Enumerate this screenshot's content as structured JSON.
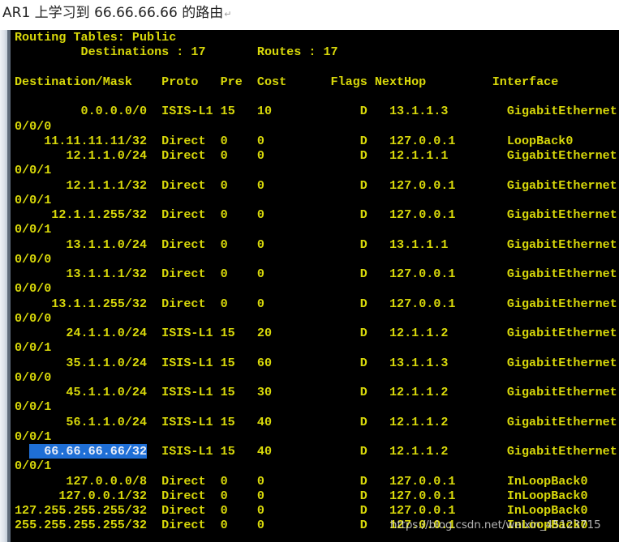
{
  "caption": {
    "text": "AR1 上学习到 66.66.66.66 的路由",
    "paragraph_mark": "↵"
  },
  "terminal": {
    "title": "Routing Tables: Public",
    "destinations_label": "Destinations",
    "destinations_count": "17",
    "routes_label": "Routes",
    "routes_count": "17",
    "columns": [
      "Destination/Mask",
      "Proto",
      "Pre",
      "Cost",
      "Flags",
      "NextHop",
      "Interface"
    ],
    "highlight_color": "#1f6fd6",
    "text_color": "#d8d80a",
    "background_color": "#000000",
    "routes": [
      {
        "dest": "0.0.0.0/0",
        "proto": "ISIS-L1",
        "pre": "15",
        "cost": "10",
        "flags": "D",
        "nexthop": "13.1.1.3",
        "iface": "GigabitEthernet",
        "iface_wrap": "0/0/0"
      },
      {
        "dest": "11.11.11.11/32",
        "proto": "Direct",
        "pre": "0",
        "cost": "0",
        "flags": "D",
        "nexthop": "127.0.0.1",
        "iface": "LoopBack0",
        "iface_wrap": ""
      },
      {
        "dest": "12.1.1.0/24",
        "proto": "Direct",
        "pre": "0",
        "cost": "0",
        "flags": "D",
        "nexthop": "12.1.1.1",
        "iface": "GigabitEthernet",
        "iface_wrap": "0/0/1"
      },
      {
        "dest": "12.1.1.1/32",
        "proto": "Direct",
        "pre": "0",
        "cost": "0",
        "flags": "D",
        "nexthop": "127.0.0.1",
        "iface": "GigabitEthernet",
        "iface_wrap": "0/0/1"
      },
      {
        "dest": "12.1.1.255/32",
        "proto": "Direct",
        "pre": "0",
        "cost": "0",
        "flags": "D",
        "nexthop": "127.0.0.1",
        "iface": "GigabitEthernet",
        "iface_wrap": "0/0/1"
      },
      {
        "dest": "13.1.1.0/24",
        "proto": "Direct",
        "pre": "0",
        "cost": "0",
        "flags": "D",
        "nexthop": "13.1.1.1",
        "iface": "GigabitEthernet",
        "iface_wrap": "0/0/0"
      },
      {
        "dest": "13.1.1.1/32",
        "proto": "Direct",
        "pre": "0",
        "cost": "0",
        "flags": "D",
        "nexthop": "127.0.0.1",
        "iface": "GigabitEthernet",
        "iface_wrap": "0/0/0"
      },
      {
        "dest": "13.1.1.255/32",
        "proto": "Direct",
        "pre": "0",
        "cost": "0",
        "flags": "D",
        "nexthop": "127.0.0.1",
        "iface": "GigabitEthernet",
        "iface_wrap": "0/0/0"
      },
      {
        "dest": "24.1.1.0/24",
        "proto": "ISIS-L1",
        "pre": "15",
        "cost": "20",
        "flags": "D",
        "nexthop": "12.1.1.2",
        "iface": "GigabitEthernet",
        "iface_wrap": "0/0/1"
      },
      {
        "dest": "35.1.1.0/24",
        "proto": "ISIS-L1",
        "pre": "15",
        "cost": "60",
        "flags": "D",
        "nexthop": "13.1.1.3",
        "iface": "GigabitEthernet",
        "iface_wrap": "0/0/0"
      },
      {
        "dest": "45.1.1.0/24",
        "proto": "ISIS-L1",
        "pre": "15",
        "cost": "30",
        "flags": "D",
        "nexthop": "12.1.1.2",
        "iface": "GigabitEthernet",
        "iface_wrap": "0/0/1"
      },
      {
        "dest": "56.1.1.0/24",
        "proto": "ISIS-L1",
        "pre": "15",
        "cost": "40",
        "flags": "D",
        "nexthop": "12.1.1.2",
        "iface": "GigabitEthernet",
        "iface_wrap": "0/0/1"
      },
      {
        "dest": "66.66.66.66/32",
        "proto": "ISIS-L1",
        "pre": "15",
        "cost": "40",
        "flags": "D",
        "nexthop": "12.1.1.2",
        "iface": "GigabitEthernet",
        "iface_wrap": "0/0/1",
        "selected": true
      },
      {
        "dest": "127.0.0.0/8",
        "proto": "Direct",
        "pre": "0",
        "cost": "0",
        "flags": "D",
        "nexthop": "127.0.0.1",
        "iface": "InLoopBack0",
        "iface_wrap": ""
      },
      {
        "dest": "127.0.0.1/32",
        "proto": "Direct",
        "pre": "0",
        "cost": "0",
        "flags": "D",
        "nexthop": "127.0.0.1",
        "iface": "InLoopBack0",
        "iface_wrap": ""
      },
      {
        "dest": "127.255.255.255/32",
        "proto": "Direct",
        "pre": "0",
        "cost": "0",
        "flags": "D",
        "nexthop": "127.0.0.1",
        "iface": "InLoopBack0",
        "iface_wrap": ""
      },
      {
        "dest": "255.255.255.255/32",
        "proto": "Direct",
        "pre": "0",
        "cost": "0",
        "flags": "D",
        "nexthop": "127.0.0.1",
        "iface": "InLoopBack0",
        "iface_wrap": ""
      }
    ]
  },
  "watermark": {
    "text": "https://blog.csdn.net/weixin_45123715"
  }
}
